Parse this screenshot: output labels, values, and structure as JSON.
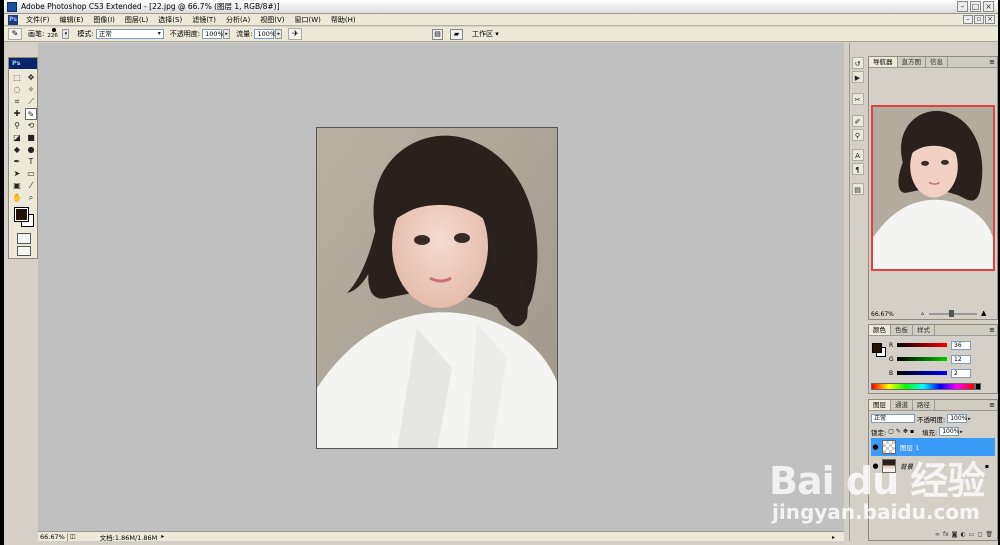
{
  "window": {
    "title": "Adobe Photoshop CS3 Extended - [22.jpg @ 66.7% (图层 1, RGB/8#)]"
  },
  "menu": {
    "ps_icon": "Ps",
    "items": [
      "文件(F)",
      "编辑(E)",
      "图像(I)",
      "图层(L)",
      "选择(S)",
      "滤镜(T)",
      "分析(A)",
      "视图(V)",
      "窗口(W)",
      "帮助(H)"
    ]
  },
  "options": {
    "brush_label": "画笔:",
    "brush_size": "226",
    "mode_label": "模式:",
    "mode_value": "正常",
    "opacity_label": "不透明度:",
    "opacity_value": "100%",
    "flow_label": "流量:",
    "flow_value": "100%",
    "workspace_label": "工作区 ▾"
  },
  "toolbox": {
    "header": "Ps"
  },
  "status": {
    "zoom": "66.67%",
    "doc": "文档:1.86M/1.86M"
  },
  "navigator": {
    "tabs": [
      "导航器",
      "直方图",
      "信息"
    ],
    "zoom": "66.67%"
  },
  "color": {
    "tabs": [
      "颜色",
      "色板",
      "样式"
    ],
    "r_label": "R",
    "r_value": "36",
    "g_label": "G",
    "g_value": "12",
    "b_label": "B",
    "b_value": "2",
    "foreground": "#241108"
  },
  "layers": {
    "tabs": [
      "图层",
      "通道",
      "路径"
    ],
    "blend_mode": "正常",
    "opacity_label": "不透明度:",
    "opacity_value": "100%",
    "lock_label": "锁定:",
    "fill_label": "填充:",
    "fill_value": "100%",
    "items": [
      {
        "name": "图层 1",
        "selected": true
      },
      {
        "name": "背景",
        "selected": false
      }
    ]
  },
  "watermark": {
    "logo": "Bai du 经验",
    "url": "jingyan.baidu.com"
  }
}
